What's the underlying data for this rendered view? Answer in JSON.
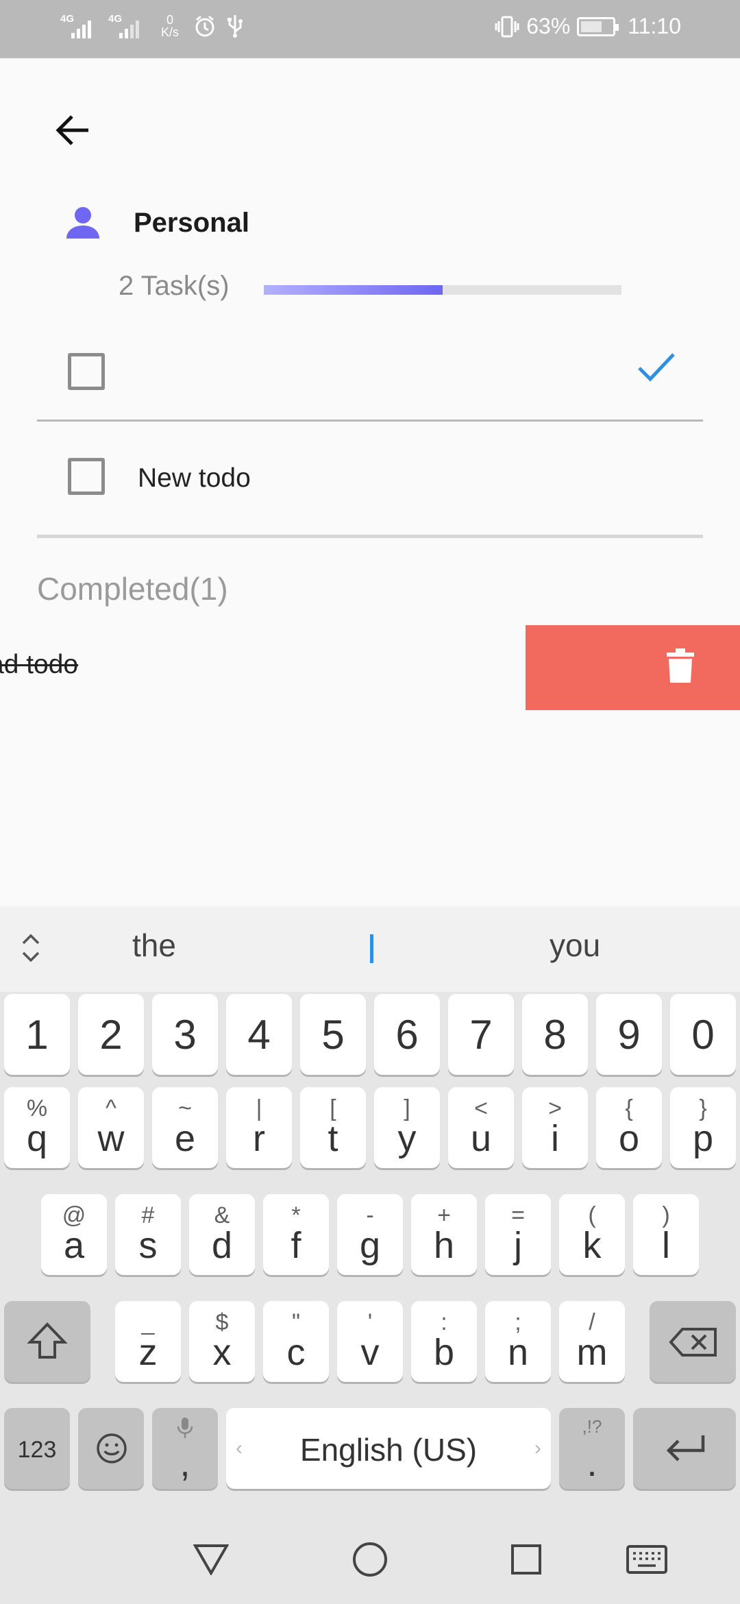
{
  "status_bar": {
    "network_1": "4G",
    "network_2": "4G",
    "speed_value": "0",
    "speed_unit": "K/s",
    "battery_percent": "63%",
    "time": "11:10",
    "icons": [
      "signal-icon",
      "alarm-icon",
      "usb-icon",
      "vibrate-icon",
      "battery-charging-icon"
    ]
  },
  "header": {
    "back_icon": "arrow-left-icon"
  },
  "category": {
    "icon": "person-icon",
    "title": "Personal",
    "task_count": "2 Task(s)",
    "progress": 0.5,
    "accent_color": "#6f66f2"
  },
  "new_todo": {
    "value": "",
    "confirm_icon": "check-icon"
  },
  "todos": [
    {
      "text": "New todo",
      "checked": false
    }
  ],
  "completed": {
    "header": "Completed(1)",
    "item_text": "ad todo",
    "delete_icon": "trash-icon",
    "delete_color": "#f26a5e"
  },
  "keyboard": {
    "suggestions": [
      "the",
      "you"
    ],
    "digits": [
      "1",
      "2",
      "3",
      "4",
      "5",
      "6",
      "7",
      "8",
      "9",
      "0"
    ],
    "row1": [
      {
        "sym": "%",
        "key": "q"
      },
      {
        "sym": "^",
        "key": "w"
      },
      {
        "sym": "~",
        "key": "e"
      },
      {
        "sym": "|",
        "key": "r"
      },
      {
        "sym": "[",
        "key": "t"
      },
      {
        "sym": "]",
        "key": "y"
      },
      {
        "sym": "<",
        "key": "u"
      },
      {
        "sym": ">",
        "key": "i"
      },
      {
        "sym": "{",
        "key": "o"
      },
      {
        "sym": "}",
        "key": "p"
      }
    ],
    "row2": [
      {
        "sym": "@",
        "key": "a"
      },
      {
        "sym": "#",
        "key": "s"
      },
      {
        "sym": "&",
        "key": "d"
      },
      {
        "sym": "*",
        "key": "f"
      },
      {
        "sym": "-",
        "key": "g"
      },
      {
        "sym": "+",
        "key": "h"
      },
      {
        "sym": "=",
        "key": "j"
      },
      {
        "sym": "(",
        "key": "k"
      },
      {
        "sym": ")",
        "key": "l"
      }
    ],
    "row3": [
      {
        "sym": "_",
        "key": "z"
      },
      {
        "sym": "$",
        "key": "x"
      },
      {
        "sym": "\"",
        "key": "c"
      },
      {
        "sym": "'",
        "key": "v"
      },
      {
        "sym": ":",
        "key": "b"
      },
      {
        "sym": ";",
        "key": "n"
      },
      {
        "sym": "/",
        "key": "m"
      }
    ],
    "numbers_label": "123",
    "comma": ",",
    "space_label": "English (US)",
    "period": ".",
    "period_sym": ",!?",
    "icons": [
      "chevron-up-down-icon",
      "shift-icon",
      "backspace-icon",
      "emoji-icon",
      "mic-icon",
      "enter-icon"
    ]
  },
  "nav_bar": {
    "icons": [
      "back-triangle-icon",
      "home-circle-icon",
      "recents-square-icon",
      "keyboard-icon"
    ]
  }
}
